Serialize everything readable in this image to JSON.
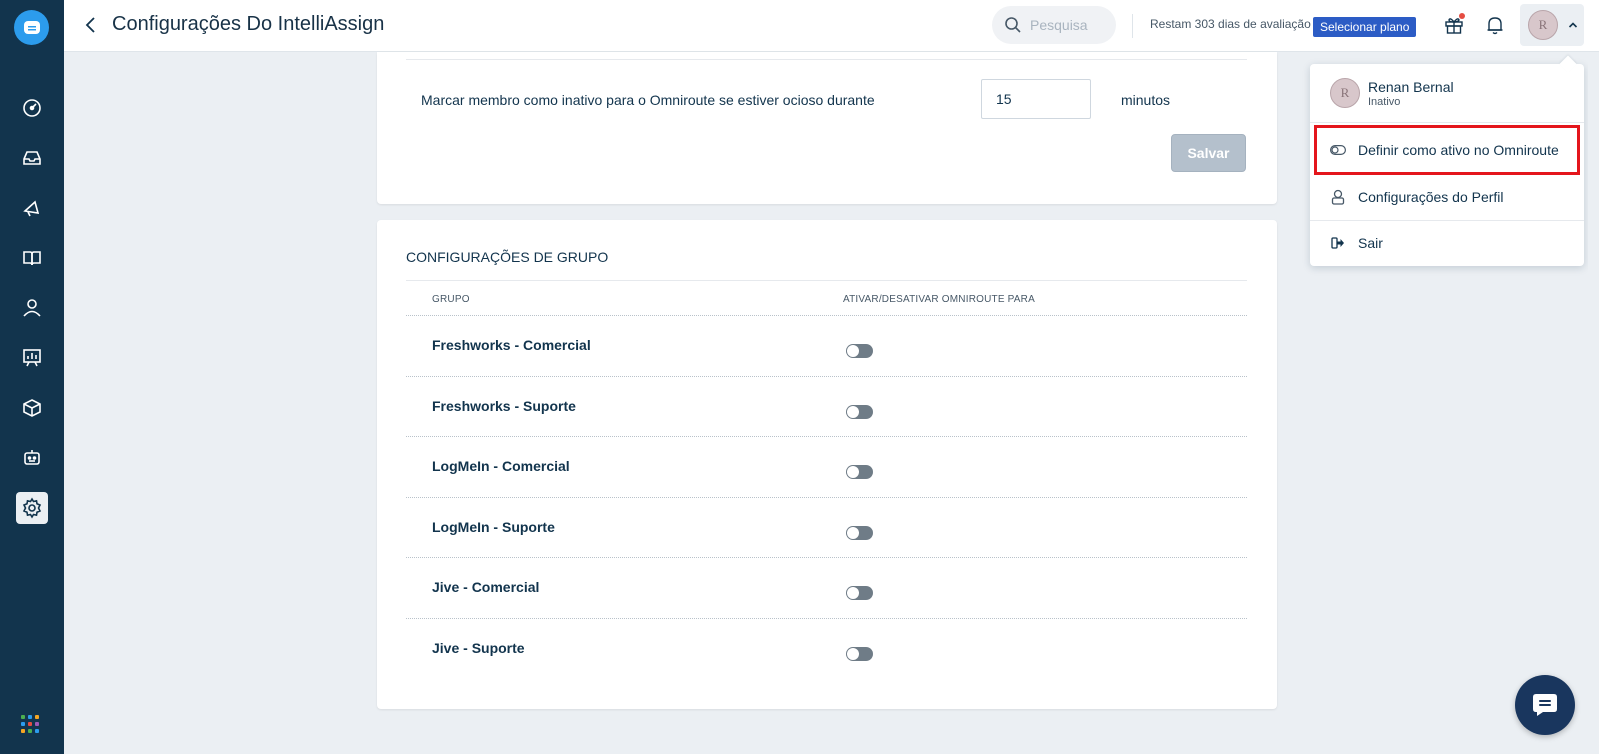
{
  "header": {
    "title": "Configurações Do IntelliAssign",
    "search_placeholder": "Pesquisa",
    "trial_text": "Restam 303 dias de avaliação",
    "plan_button": "Selecionar plano",
    "avatar_initial": "R"
  },
  "sidebar": {
    "items": [
      {
        "icon": "dashboard-icon"
      },
      {
        "icon": "inbox-icon"
      },
      {
        "icon": "megaphone-icon"
      },
      {
        "icon": "book-icon"
      },
      {
        "icon": "contacts-icon"
      },
      {
        "icon": "reports-icon"
      },
      {
        "icon": "box-icon"
      },
      {
        "icon": "bot-icon"
      },
      {
        "icon": "settings-icon",
        "active": true
      }
    ]
  },
  "idle": {
    "label": "Marcar membro como inativo para o Omniroute se estiver ocioso durante",
    "value": "15",
    "unit": "minutos",
    "save": "Salvar"
  },
  "groups": {
    "title": "CONFIGURAÇÕES DE GRUPO",
    "col_group": "GRUPO",
    "col_toggle": "ATIVAR/DESATIVAR OMNIROUTE PARA",
    "rows": [
      {
        "name": "Freshworks - Comercial",
        "enabled": false
      },
      {
        "name": "Freshworks - Suporte",
        "enabled": false
      },
      {
        "name": "LogMeIn - Comercial",
        "enabled": false
      },
      {
        "name": "LogMeIn - Suporte",
        "enabled": false
      },
      {
        "name": "Jive - Comercial",
        "enabled": false
      },
      {
        "name": "Jive - Suporte",
        "enabled": false
      }
    ]
  },
  "dropdown": {
    "user_name": "Renan Bernal",
    "user_status": "Inativo",
    "avatar_initial": "R",
    "set_active": "Definir como ativo no Omniroute",
    "profile_settings": "Configurações do Perfil",
    "logout": "Sair"
  },
  "colors": {
    "sidebar": "#12344d",
    "accent": "#2c5cc5",
    "highlight": "#e4161c"
  }
}
